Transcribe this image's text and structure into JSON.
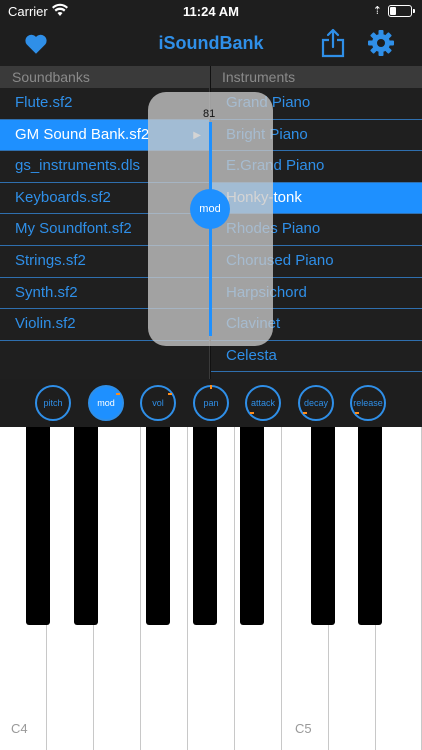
{
  "status": {
    "carrier": "Carrier",
    "time": "11:24 AM"
  },
  "nav": {
    "title": "iSoundBank"
  },
  "soundbanks": {
    "header": "Soundbanks",
    "items": [
      "Flute.sf2",
      "GM Sound Bank.sf2",
      "gs_instruments.dls",
      "Keyboards.sf2",
      "My Soundfont.sf2",
      "Strings.sf2",
      "Synth.sf2",
      "Violin.sf2"
    ],
    "selected_arrow": "▶"
  },
  "instruments": {
    "header": "Instruments",
    "items": [
      "Grand Piano",
      "Bright Piano",
      "E.Grand Piano",
      "Honky-tonk",
      "Rhodes Piano",
      "Chorused Piano",
      "Harpsichord",
      "Clavinet",
      "Celesta"
    ]
  },
  "slider": {
    "label": "mod",
    "value": "81"
  },
  "knobs": [
    "pitch",
    "mod",
    "vol",
    "pan",
    "attack",
    "decay",
    "release"
  ],
  "keyboard": {
    "c4": "C4",
    "c5": "C5"
  },
  "colors": {
    "accent": "#2f8fe8",
    "selected": "#1e90ff",
    "background": "#1f1f1f",
    "header": "#3a3a3a"
  }
}
